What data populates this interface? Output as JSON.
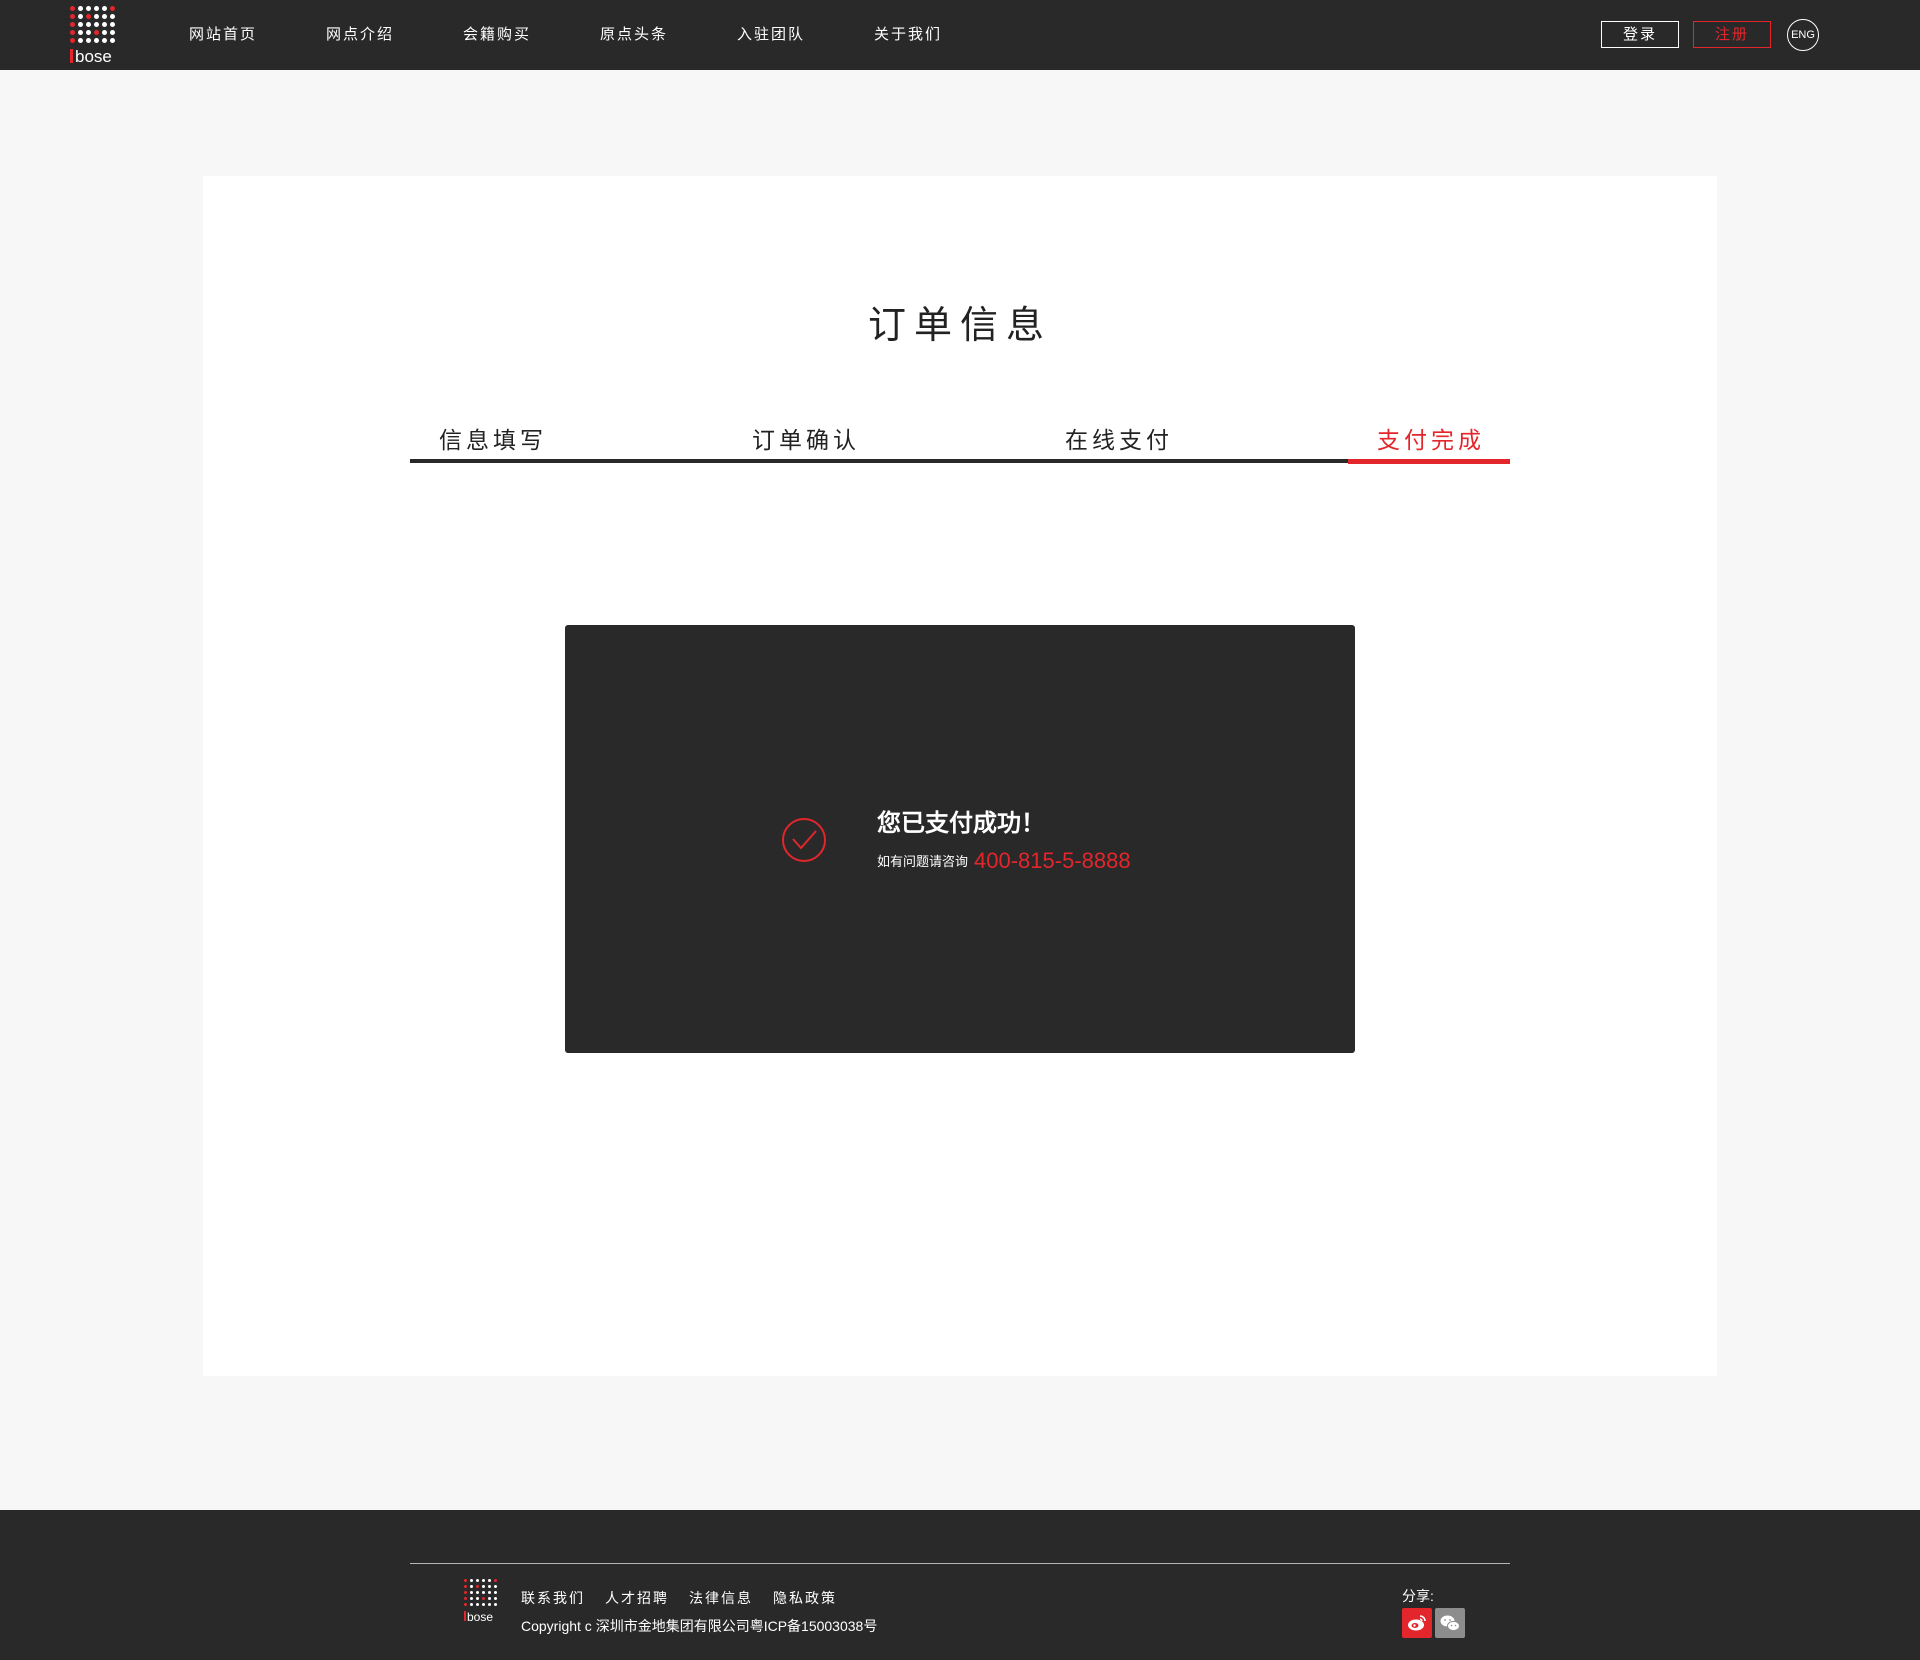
{
  "header": {
    "logo_text": "bose",
    "nav": [
      "网站首页",
      "网点介绍",
      "会籍购买",
      "原点头条",
      "入驻团队",
      "关于我们"
    ],
    "login_label": "登录",
    "register_label": "注册",
    "lang_label": "ENG"
  },
  "main": {
    "title": "订单信息",
    "steps": [
      "信息填写",
      "订单确认",
      "在线支付",
      "支付完成"
    ],
    "active_step": 3,
    "success": {
      "title": "您已支付成功！",
      "help_text": "如有问题请咨询",
      "phone": "400-815-5-8888",
      "icon": "check-circle-icon"
    }
  },
  "footer": {
    "logo_text": "bose",
    "links": [
      "联系我们",
      "人才招聘",
      "法律信息",
      "隐私政策"
    ],
    "copyright": "Copyright c 深圳市金地集团有限公司粤ICP备15003038号",
    "share_label": "分享:",
    "share_icons": [
      "weibo-icon",
      "wechat-icon"
    ]
  },
  "colors": {
    "accent": "#e3262b",
    "dark": "#292929",
    "page_bg": "#f7f7f7"
  }
}
